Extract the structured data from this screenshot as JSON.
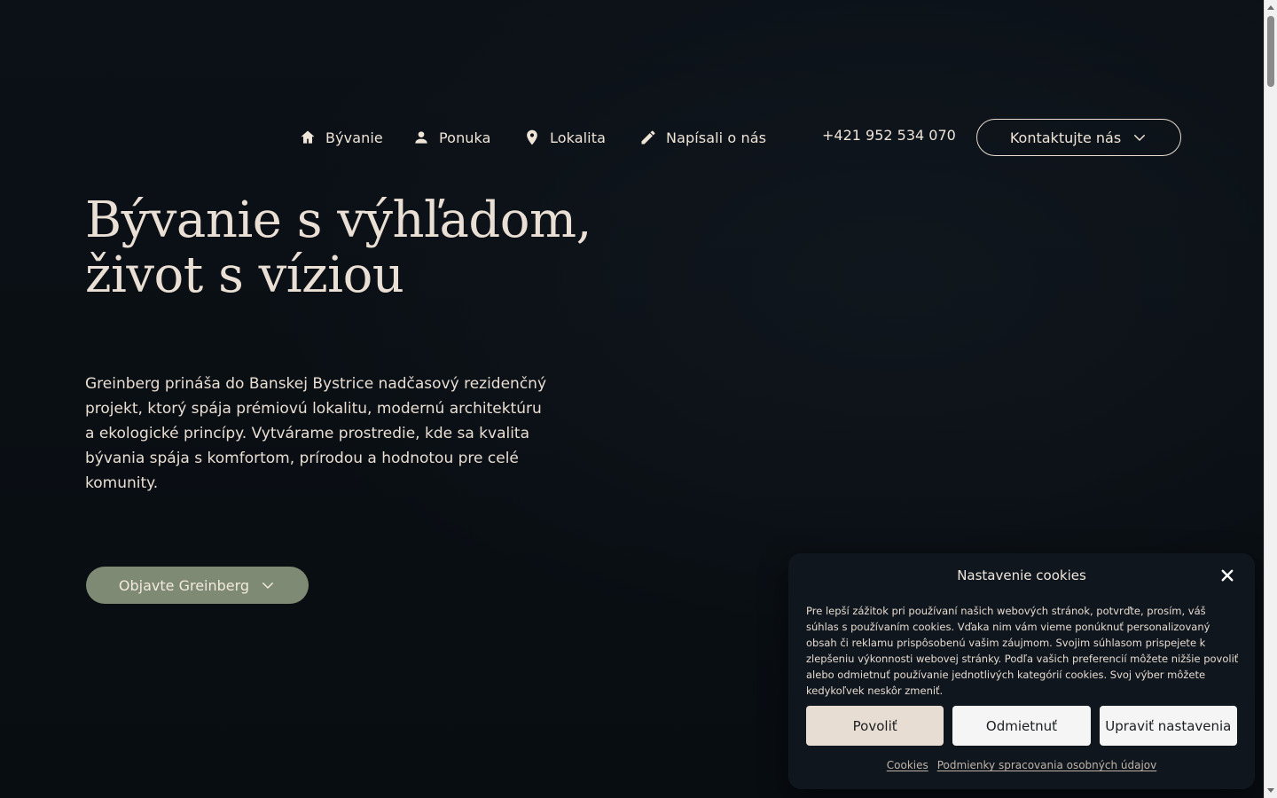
{
  "nav": {
    "items": [
      {
        "label": "Bývanie",
        "icon": "home-icon"
      },
      {
        "label": "Ponuka",
        "icon": "user-icon"
      },
      {
        "label": "Lokalita",
        "icon": "location-pin-icon"
      },
      {
        "label": "Napísali o nás",
        "icon": "pencil-icon"
      }
    ],
    "phone": "+421 952 534 070",
    "contact_button": "Kontaktujte nás"
  },
  "hero": {
    "title_line1": "Bývanie s výhľadom,",
    "title_line2": "život s víziou",
    "paragraph": "Greinberg prináša do Banskej Bystrice nadčasový rezidenčný projekt, ktorý spája prémiovú lokalitu, modernú architektúru a ekologické princípy. Vytvárame prostredie, kde sa kvalita bývania spája s komfortom, prírodou a hodnotou pre celé komunity.",
    "cta": "Objavte Greinberg"
  },
  "cookie": {
    "title": "Nastavenie cookies",
    "text": "Pre lepší zážitok pri používaní našich webových stránok, potvrďte, prosím, váš súhlas s používaním cookies. Vďaka nim vám vieme ponúknuť personalizovaný obsah či reklamu prispôsobenú vašim záujmom. Svojim súhlasom prispejete k zlepšeniu výkonnosti webovej stránky. Podľa vašich preferencií môžete nižšie povoliť alebo odmietnuť používanie jednotlivých kategórií cookies. Svoj výber môžete kedykoľvek neskôr zmeniť.",
    "buttons": {
      "accept": "Povoliť",
      "deny": "Odmietnuť",
      "settings": "Upraviť nastavenia"
    },
    "links": {
      "cookies": "Cookies",
      "privacy": "Podmienky spracovania osobných údajov"
    }
  },
  "colors": {
    "background": "#0a0f14",
    "text": "#efe4d8",
    "accent_green": "#7f8a74",
    "cookie_accept": "#e8ddd2"
  }
}
